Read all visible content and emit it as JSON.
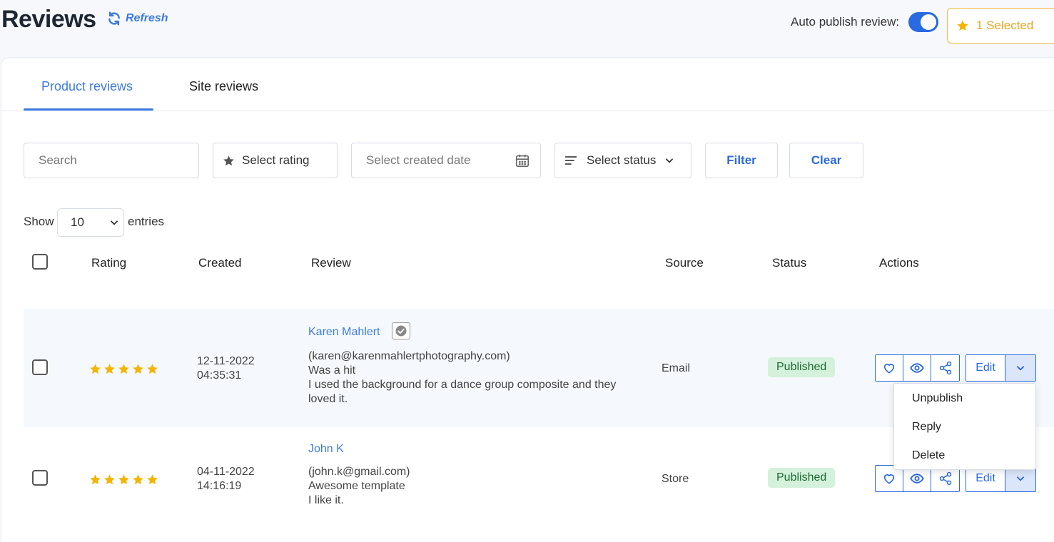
{
  "header": {
    "title": "Reviews",
    "refresh_label": "Refresh",
    "auto_publish_label": "Auto publish review:",
    "auto_publish_on": true,
    "selected_label": "1 Selected"
  },
  "tabs": [
    {
      "label": "Product reviews",
      "active": true
    },
    {
      "label": "Site reviews",
      "active": false
    }
  ],
  "filters": {
    "search_placeholder": "Search",
    "rating_label": "Select rating",
    "date_placeholder": "Select created date",
    "status_label": "Select status",
    "filter_label": "Filter",
    "clear_label": "Clear"
  },
  "entries": {
    "show_label": "Show",
    "value": "10",
    "entries_label": "entries"
  },
  "table": {
    "headers": [
      "Rating",
      "Created",
      "Review",
      "Source",
      "Status",
      "Actions"
    ],
    "rows": [
      {
        "rating": 5,
        "created_date": "12-11-2022",
        "created_time": "04:35:31",
        "name": "Karen Mahlert",
        "verified": true,
        "email": "(karen@karenmahlertphotography.com)",
        "title": "Was a hit",
        "body": "I used the background for a dance group composite and they loved it.",
        "source": "Email",
        "status": "Published",
        "edit_label": "Edit"
      },
      {
        "rating": 5,
        "created_date": "04-11-2022",
        "created_time": "14:16:19",
        "name": "John K",
        "verified": false,
        "email": "(john.k@gmail.com)",
        "title": "Awesome template",
        "body": "I like it.",
        "source": "Store",
        "status": "Published",
        "edit_label": "Edit"
      }
    ]
  },
  "dropdown_menu": {
    "items": [
      "Unpublish",
      "Reply",
      "Delete"
    ]
  },
  "colors": {
    "accent": "#2a6ae0",
    "star": "#f5b400",
    "published_bg": "#d4f1db",
    "published_text": "#1c6a33"
  }
}
